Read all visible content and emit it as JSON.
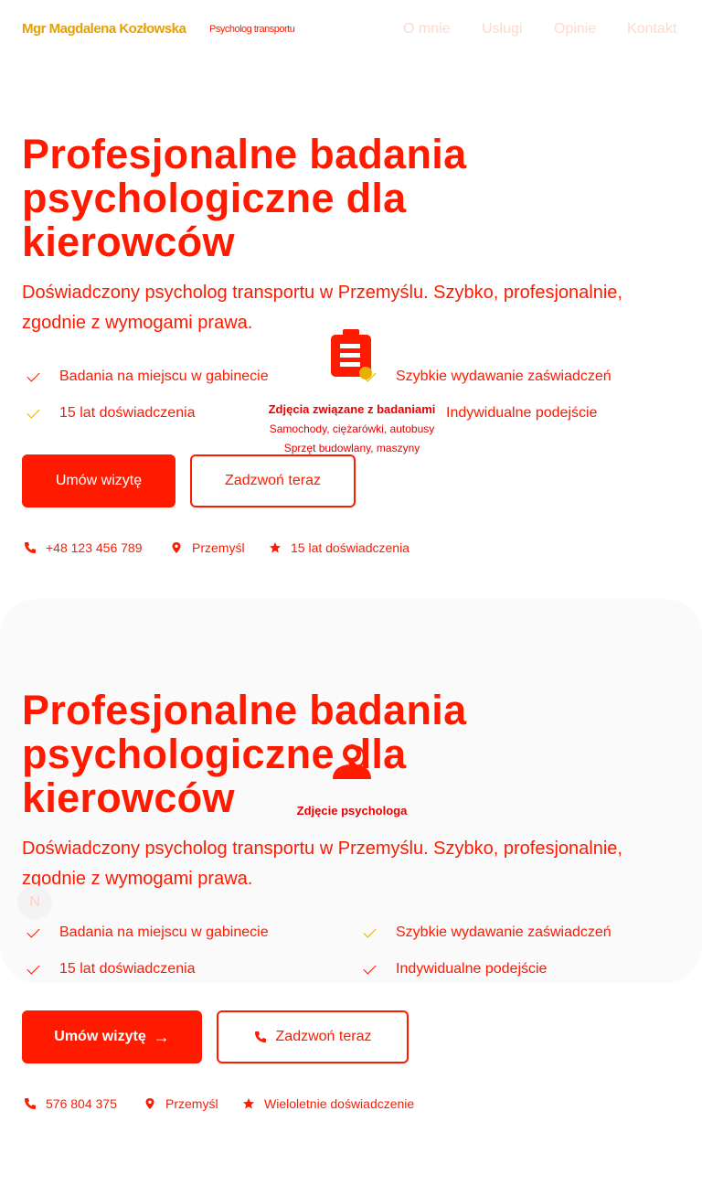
{
  "nav": {
    "brand": "Mgr Magdalena Kozłowska",
    "brand_sub": "Psycholog transportu",
    "links": [
      "O mnie",
      "Usługi",
      "Opinie",
      "Kontakt"
    ]
  },
  "hero1": {
    "title": "Profesjonalne badania psychologiczne dla kierowców",
    "lead": "Doświadczony psycholog transportu w Przemyślu. Szybko, profesjonalnie, zgodnie z wymogami prawa.",
    "features": [
      "Badania na miejscu w gabinecie",
      "Szybkie wydawanie zaświadczeń",
      "15 lat doświadczenia",
      "Indywidualne podejście"
    ],
    "btn_primary": "Umów wizytę",
    "btn_secondary": "Zadzwoń teraz",
    "phone": "+48 123 456 789",
    "city": "Przemyśl",
    "experience": "15 lat doświadczenia",
    "image_caption": "Zdjęcia związane z badaniami",
    "image_line1": "Samochody, ciężarówki, autobusy",
    "image_line2": "Sprzęt budowlany, maszyny"
  },
  "hero2": {
    "title": "Profesjonalne badania psychologiczne dla kierowców",
    "lead": "Doświadczony psycholog transportu w Przemyślu. Szybko, profesjonalnie, zgodnie z wymogami prawa.",
    "features": [
      "Badania na miejscu w gabinecie",
      "Szybkie wydawanie zaświadczeń",
      "15 lat doświadczenia",
      "Indywidualne podejście"
    ],
    "btn_primary": "Umów wizytę",
    "btn_secondary": "Zadzwoń teraz",
    "phone": "576 804 375",
    "city": "Przemyśl",
    "experience": "Wieloletnie doświadczenie",
    "image_caption": "Zdjęcie psychologa"
  },
  "badge": "N",
  "colors": {
    "accent": "#ff1a00",
    "gold": "#e8a000"
  }
}
